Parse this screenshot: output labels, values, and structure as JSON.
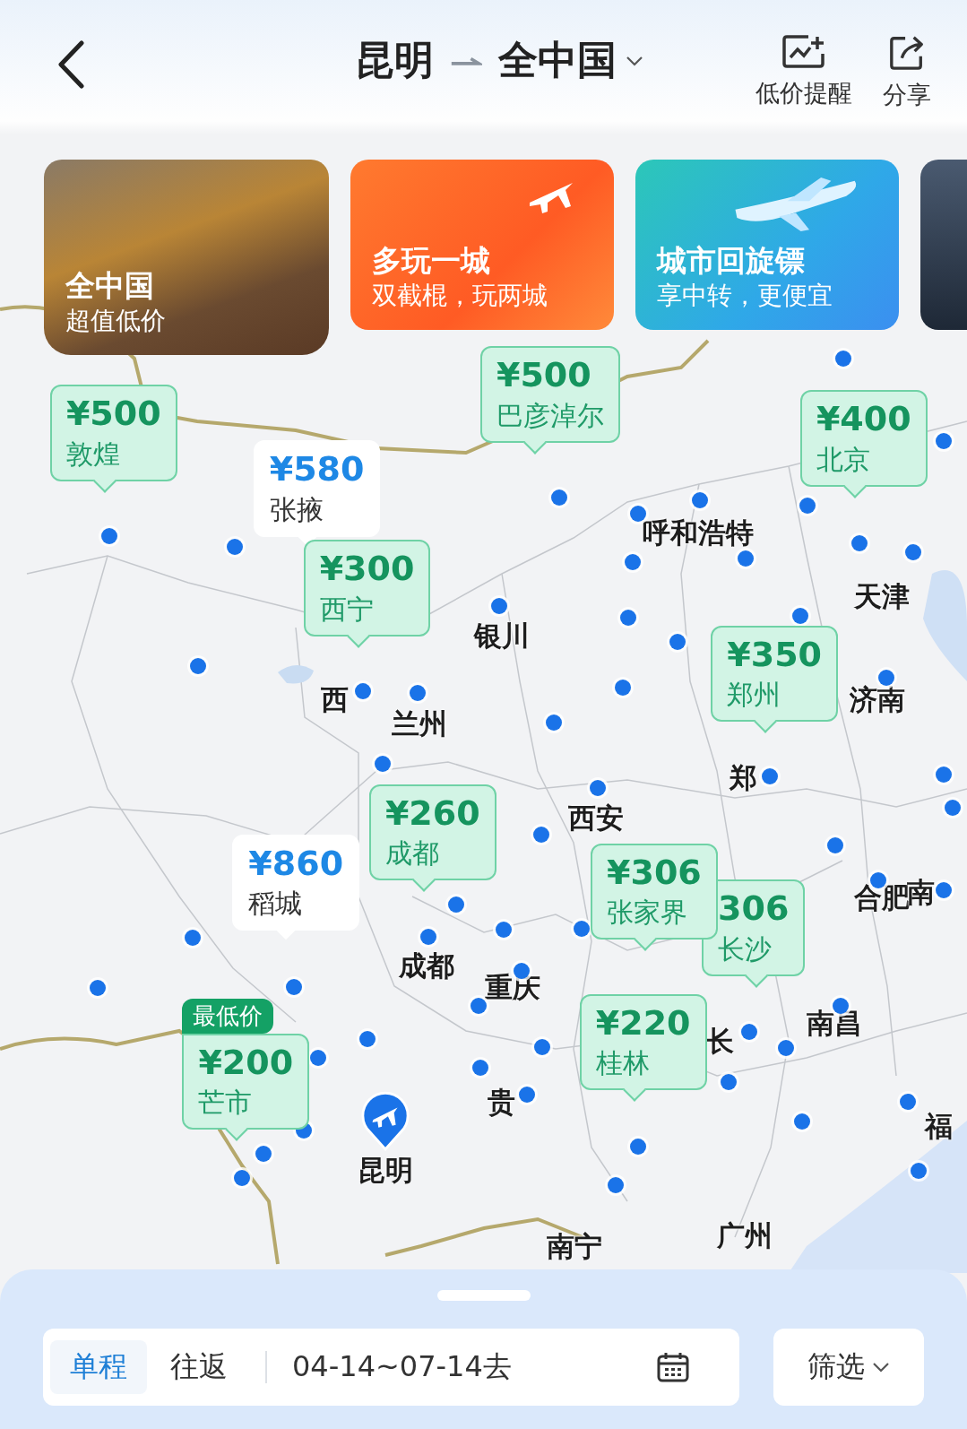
{
  "header": {
    "origin": "昆明",
    "destination": "全中国",
    "actions": [
      {
        "kind": "alert",
        "label": "低价提醒"
      },
      {
        "kind": "share",
        "label": "分享"
      }
    ]
  },
  "cards": [
    {
      "kind": "photo",
      "title": "全中国",
      "subtitle": "超值低价"
    },
    {
      "kind": "orange",
      "title": "多玩一城",
      "subtitle": "双截棍，玩两城"
    },
    {
      "kind": "blue",
      "title": "城市回旋镖",
      "subtitle": "享中转，更便宜"
    },
    {
      "kind": "dark"
    }
  ],
  "map": {
    "city_labels": [
      "呼和浩特",
      "银川",
      "天津",
      "济南",
      "西",
      "兰州",
      "西安",
      "郑",
      "成都",
      "重庆",
      "贵",
      "长",
      "南昌",
      "合肥",
      "南",
      "福",
      "南宁",
      "广州"
    ],
    "origin_marker": {
      "city": "昆明"
    },
    "price_markers": [
      {
        "kind": "highlight",
        "price": "¥500",
        "city": "敦煌"
      },
      {
        "kind": "plain",
        "price": "¥580",
        "city": "张掖"
      },
      {
        "kind": "highlight",
        "price": "¥500",
        "city": "巴彦淖尔"
      },
      {
        "kind": "highlight",
        "price": "¥400",
        "city": "北京"
      },
      {
        "kind": "highlight",
        "price": "¥300",
        "city": "西宁"
      },
      {
        "kind": "highlight",
        "price": "¥350",
        "city": "郑州"
      },
      {
        "kind": "highlight",
        "price": "¥260",
        "city": "成都"
      },
      {
        "kind": "plain",
        "price": "¥860",
        "city": "稻城"
      },
      {
        "kind": "highlight",
        "price": "306",
        "city": "长沙"
      },
      {
        "kind": "highlight",
        "price": "¥306",
        "city": "张家界"
      },
      {
        "kind": "highlight",
        "price": "¥200",
        "city": "芒市",
        "badge": "最低价"
      },
      {
        "kind": "highlight",
        "price": "¥220",
        "city": "桂林"
      }
    ]
  },
  "bottom": {
    "trip_types": [
      {
        "label": "单程",
        "selected": true
      },
      {
        "label": "往返",
        "selected": false
      }
    ],
    "dates": "04-14~07-14去",
    "filter": "筛选"
  }
}
